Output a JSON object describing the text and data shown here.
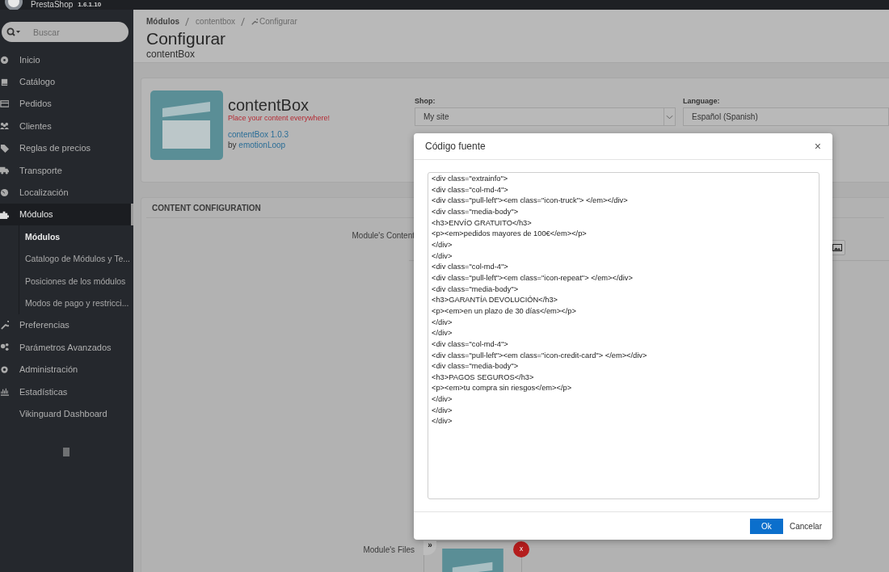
{
  "brand": {
    "name": "PrestaShop",
    "version": "1.6.1.10"
  },
  "search": {
    "placeholder": "Buscar"
  },
  "sidebar": {
    "items": [
      {
        "label": "Inicio",
        "selected": false
      },
      {
        "label": "Catálogo",
        "selected": false
      },
      {
        "label": "Pedidos",
        "selected": false
      },
      {
        "label": "Clientes",
        "selected": false
      },
      {
        "label": "Reglas de precios",
        "selected": false
      },
      {
        "label": "Transporte",
        "selected": false
      },
      {
        "label": "Localización",
        "selected": false
      },
      {
        "label": "Módulos",
        "selected": true,
        "children": [
          {
            "label": "Módulos",
            "selected": true
          },
          {
            "label": "Catalogo de Módulos y Te...",
            "selected": false
          },
          {
            "label": "Posiciones de los módulos",
            "selected": false
          },
          {
            "label": "Modos de pago y restricci...",
            "selected": false
          }
        ]
      },
      {
        "label": "Preferencias",
        "selected": false
      },
      {
        "label": "Parámetros Avanzados",
        "selected": false
      },
      {
        "label": "Administración",
        "selected": false
      },
      {
        "label": "Estadísticas",
        "selected": false
      },
      {
        "label": "Vikinguard Dashboard",
        "selected": false
      }
    ]
  },
  "breadcrumb": [
    "Módulos",
    "contentbox",
    "Configurar"
  ],
  "page": {
    "title": "Configurar",
    "subtitle": "contentBox"
  },
  "module": {
    "name": "contentBox",
    "tagline": "Place your content everywhere!",
    "version": "contentBox 1.0.3",
    "by": "by",
    "author": "emotionLoop",
    "shop": {
      "label": "Shop:",
      "value": "My site"
    },
    "language": {
      "label": "Language:",
      "value": "Español (Spanish)"
    }
  },
  "config": {
    "title": "CONTENT CONFIGURATION",
    "content_label": "Module's Content",
    "files_label": "Module's Files",
    "thumb_badge": "x",
    "thumb_nav": "»"
  },
  "dialog": {
    "title": "Código fuente",
    "close": "×",
    "source_lines": [
      "<div class=\"extrainfo\">",
      "<div class=\"col-md-4\">",
      "<div class=\"pull-left\"><em class=\"icon-truck\"> </em></div>",
      "<div class=\"media-body\">",
      "<h3>ENVÍO GRATUITO</h3>",
      "<p><em>pedidos mayores de 100€</em></p>",
      "</div>",
      "</div>",
      "<div class=\"col-md-4\">",
      "<div class=\"pull-left\"><em class=\"icon-repeat\"> </em></div>",
      "<div class=\"media-body\">",
      "<h3>GARANTÍA DEVOLUCIÓN</h3>",
      "<p><em>en un plazo de 30 días</em></p>",
      "</div>",
      "</div>",
      "<div class=\"col-md-4\">",
      "<div class=\"pull-left\"><em class=\"icon-credit-card\"> </em></div>",
      "<div class=\"media-body\">",
      "<h3>PAGOS SEGUROS</h3>",
      "<p><em>tu compra sin riesgos</em></p>",
      "</div>",
      "</div>",
      "</div>"
    ],
    "buttons": [
      {
        "label": "Ok",
        "kind": "primary"
      },
      {
        "label": "Cancelar",
        "kind": "link"
      }
    ]
  }
}
